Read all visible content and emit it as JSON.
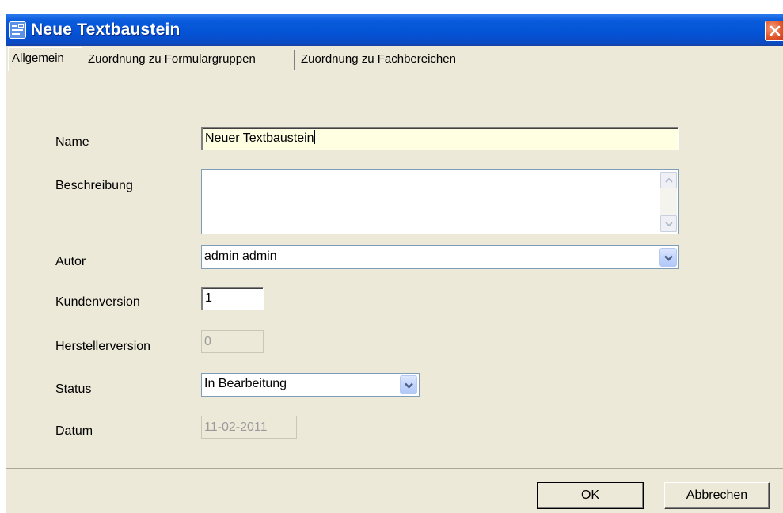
{
  "window": {
    "title": "Neue Textbaustein",
    "icons": {
      "app": "text-block-icon",
      "close": "close-icon"
    }
  },
  "tabs": [
    {
      "label": "Allgemein",
      "active": true
    },
    {
      "label": "Zuordnung zu Formulargruppen",
      "active": false
    },
    {
      "label": "Zuordnung zu Fachbereichen",
      "active": false
    }
  ],
  "form": {
    "name": {
      "label": "Name",
      "value": "Neuer Textbaustein"
    },
    "beschreibung": {
      "label": "Beschreibung",
      "value": ""
    },
    "autor": {
      "label": "Autor",
      "value": "admin admin"
    },
    "kundenversion": {
      "label": "Kundenversion",
      "value": "1"
    },
    "herstellerversion": {
      "label": "Herstellerversion",
      "value": "0"
    },
    "status": {
      "label": "Status",
      "value": "In Bearbeitung"
    },
    "datum": {
      "label": "Datum",
      "value": "11-02-2011"
    }
  },
  "buttons": {
    "ok": "OK",
    "cancel": "Abbrechen"
  },
  "colors": {
    "titlebar": "#0453d6",
    "dialog_bg": "#ece9d8",
    "name_field_bg": "#ffffe1",
    "close_button": "#e2562b"
  }
}
